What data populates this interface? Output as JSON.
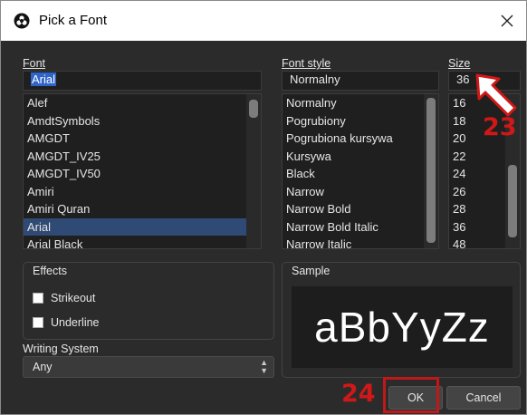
{
  "window": {
    "title": "Pick a Font"
  },
  "font": {
    "label": "Font",
    "input_value": "Arial",
    "items": [
      "Alef",
      "AmdtSymbols",
      "AMGDT",
      "AMGDT_IV25",
      "AMGDT_IV50",
      "Amiri",
      "Amiri Quran",
      "Arial",
      "Arial Black"
    ],
    "selected_index": 7
  },
  "font_style": {
    "label": "Font style",
    "input_value": "Normalny",
    "items": [
      "Normalny",
      "Pogrubiony",
      "Pogrubiona kursywa",
      "Kursywa",
      "Black",
      "Narrow",
      "Narrow Bold",
      "Narrow Bold Italic",
      "Narrow Italic"
    ]
  },
  "size": {
    "label": "Size",
    "input_value": "36",
    "items": [
      "16",
      "18",
      "20",
      "22",
      "24",
      "26",
      "28",
      "36",
      "48"
    ]
  },
  "effects": {
    "title": "Effects",
    "strikeout": "Strikeout",
    "underline": "Underline"
  },
  "sample": {
    "title": "Sample",
    "text": "aBbYyZz"
  },
  "writing_system": {
    "label": "Writing System",
    "value": "Any"
  },
  "buttons": {
    "ok": "OK",
    "cancel": "Cancel"
  },
  "annotations": {
    "step23": "23",
    "step24": "24"
  },
  "colors": {
    "accent_red": "#d01818",
    "selection": "#2f65ca",
    "dialog_bg": "#2b2b2b"
  }
}
